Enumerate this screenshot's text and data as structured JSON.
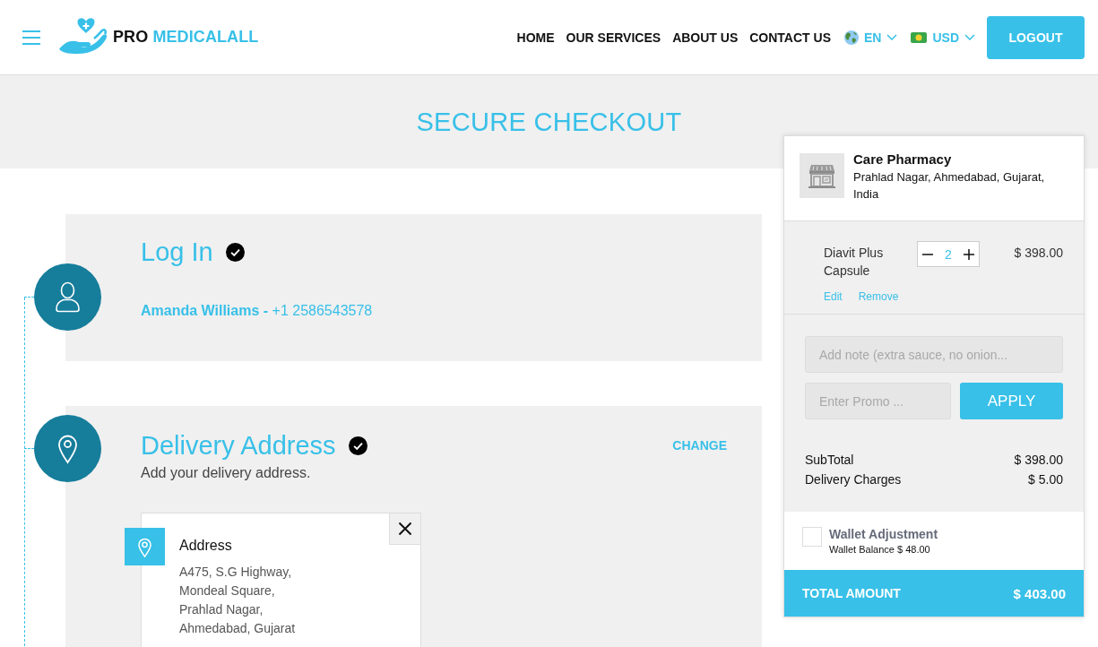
{
  "header": {
    "logo": {
      "brand_first": "PRO",
      "brand_second": "MEDICALALL"
    },
    "nav": [
      "HOME",
      "OUR SERVICES",
      "ABOUT US",
      "CONTACT US"
    ],
    "language": "EN",
    "currency": "USD",
    "logout": "LOGOUT"
  },
  "page_title": "SECURE CHECKOUT",
  "steps": [
    {
      "kind": "login",
      "title": "Log In",
      "completed": true,
      "user": "**Amanda Williams -** +1 2586543578"
    },
    {
      "kind": "address",
      "title": "Delivery Address",
      "completed": true,
      "subtitle": "Add your delivery address.",
      "action": "CHANGE",
      "address_card": {
        "label": "Address",
        "lines": [
          "A475, S.G Highway,",
          "Mondeal Square,",
          "Prahlad Nagar,",
          "Ahmedabad, Gujarat"
        ]
      }
    }
  ],
  "cart": {
    "store": {
      "name": "Care Pharmacy",
      "location": "Prahlad Nagar, Ahmedabad, Gujarat, India"
    },
    "items": [
      {
        "name": "Diavit Plus Capsule",
        "quantity": "2",
        "price": "$ 398.00",
        "edit": "Edit",
        "remove": "Remove"
      }
    ],
    "note": {
      "placeholder": "Add note (extra sauce, no onion..."
    },
    "promo": {
      "placeholder": "Enter Promo ...",
      "button": "APPLY"
    },
    "summary": [
      {
        "label": "SubTotal",
        "value": "$ 398.00"
      },
      {
        "label": "Delivery Charges",
        "value": "$ 5.00"
      }
    ],
    "wallet": {
      "checked": false,
      "title": "Wallet Adjustment",
      "balance": "Wallet Balance $ 48.00"
    },
    "total": {
      "label": "TOTAL AMOUNT",
      "value": "$ 403.00"
    }
  }
}
